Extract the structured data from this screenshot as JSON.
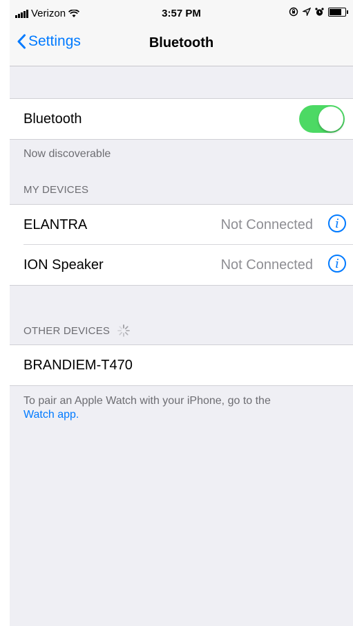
{
  "status_bar": {
    "carrier": "Verizon",
    "time": "3:57 PM"
  },
  "nav": {
    "back_label": "Settings",
    "title": "Bluetooth"
  },
  "bluetooth": {
    "label": "Bluetooth",
    "enabled": true,
    "discoverable_text": "Now discoverable"
  },
  "my_devices": {
    "header": "MY DEVICES",
    "items": [
      {
        "name": "ELANTRA",
        "status": "Not Connected"
      },
      {
        "name": "ION Speaker",
        "status": "Not Connected"
      }
    ]
  },
  "other_devices": {
    "header": "OTHER DEVICES",
    "items": [
      {
        "name": "BRANDIEM-T470"
      }
    ]
  },
  "footer": {
    "text": "To pair an Apple Watch with your iPhone, go to the",
    "link": "Watch app."
  },
  "colors": {
    "accent": "#007aff",
    "toggle_on": "#4cd964",
    "background": "#efeff4",
    "secondary_text": "#8e8e93"
  }
}
